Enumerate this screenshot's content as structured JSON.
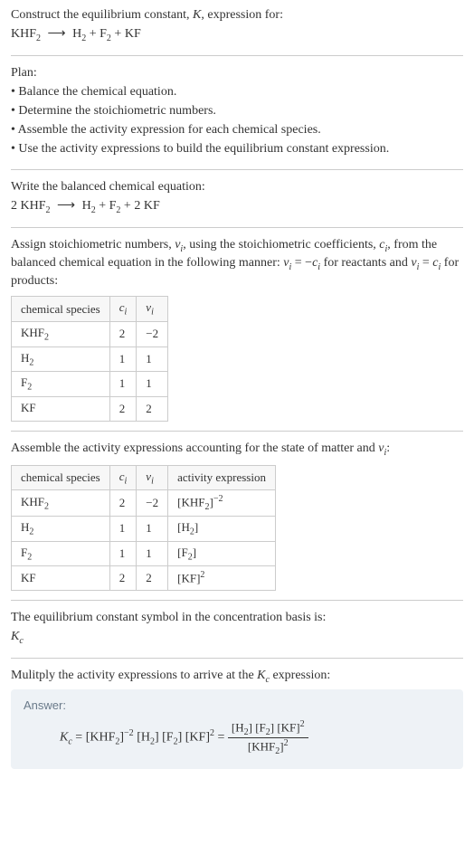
{
  "intro": {
    "line1": "Construct the equilibrium constant, ",
    "Kvar": "K",
    "line1b": ", expression for:",
    "equation_lhs": "KHF",
    "equation_rhs": "H",
    "equation_rhs2": "F",
    "equation_rhs3": "KF",
    "arrow": "⟶",
    "plus": " + "
  },
  "plan": {
    "title": "Plan:",
    "b1": "• Balance the chemical equation.",
    "b2": "• Determine the stoichiometric numbers.",
    "b3": "• Assemble the activity expression for each chemical species.",
    "b4": "• Use the activity expressions to build the equilibrium constant expression."
  },
  "balanced": {
    "title": "Write the balanced chemical equation:",
    "coef1": "2 ",
    "coef2": "2 "
  },
  "stoich": {
    "text1": "Assign stoichiometric numbers, ",
    "nu": "ν",
    "sub_i": "i",
    "text2": ", using the stoichiometric coefficients, ",
    "c": "c",
    "text3": ", from the balanced chemical equation in the following manner: ",
    "rel_react": " = −",
    "text4": " for reactants and ",
    "rel_prod": " = ",
    "text5": " for products:",
    "headers": {
      "col1": "chemical species",
      "col2": "c",
      "col3": "ν"
    },
    "rows": [
      {
        "name": "KHF",
        "sub": "2",
        "c": "2",
        "v": "−2"
      },
      {
        "name": "H",
        "sub": "2",
        "c": "1",
        "v": "1"
      },
      {
        "name": "F",
        "sub": "2",
        "c": "1",
        "v": "1"
      },
      {
        "name": "KF",
        "sub": "",
        "c": "2",
        "v": "2"
      }
    ]
  },
  "activity": {
    "title": "Assemble the activity expressions accounting for the state of matter and ",
    "headers": {
      "col1": "chemical species",
      "col2": "c",
      "col3": "ν",
      "col4": "activity expression"
    },
    "rows": [
      {
        "name": "KHF",
        "sub": "2",
        "c": "2",
        "v": "−2",
        "expr_base": "[KHF",
        "expr_sub": "2",
        "expr_sup": "−2"
      },
      {
        "name": "H",
        "sub": "2",
        "c": "1",
        "v": "1",
        "expr_base": "[H",
        "expr_sub": "2",
        "expr_sup": ""
      },
      {
        "name": "F",
        "sub": "2",
        "c": "1",
        "v": "1",
        "expr_base": "[F",
        "expr_sub": "2",
        "expr_sup": ""
      },
      {
        "name": "KF",
        "sub": "",
        "c": "2",
        "v": "2",
        "expr_base": "[KF",
        "expr_sub": "",
        "expr_sup": "2"
      }
    ]
  },
  "symbol": {
    "title": "The equilibrium constant symbol in the concentration basis is:",
    "K": "K",
    "c": "c"
  },
  "multiply": {
    "title1": "Mulitply the activity expressions to arrive at the ",
    "title2": " expression:"
  },
  "answer": {
    "label": "Answer:",
    "eq": " = ",
    "t1": "[KHF",
    "t1_sub": "2",
    "t1_sup": "−2",
    "t2": " [H",
    "t2_sub": "2",
    "t3": "] [F",
    "t3_sub": "2",
    "t4": "] [KF]",
    "t4_sup": "2",
    "eq2": " = ",
    "num1": "[H",
    "num2": "] [F",
    "num3": "] [KF]",
    "num_sup": "2",
    "den1": "[KHF",
    "den_sub": "2",
    "den_sup": "2"
  }
}
